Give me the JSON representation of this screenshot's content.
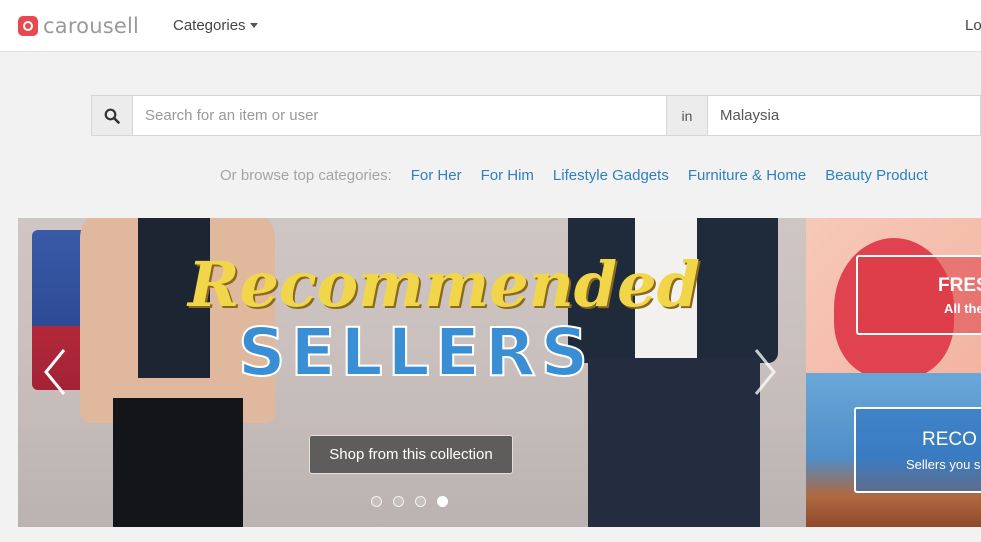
{
  "header": {
    "logo_text": "carousell",
    "categories_label": "Categories",
    "login_label": "Lo"
  },
  "search": {
    "placeholder": "Search for an item or user",
    "value": "",
    "in_label": "in",
    "location": "Malaysia"
  },
  "browse": {
    "label": "Or browse top categories:",
    "links": [
      "For Her",
      "For Him",
      "Lifestyle Gadgets",
      "Furniture & Home",
      "Beauty Product"
    ]
  },
  "banner": {
    "title_script": "Recommended",
    "title_main": "SELLERS",
    "cta_label": "Shop from this collection",
    "slide_count": 4,
    "active_slide": 4
  },
  "side_promos": [
    {
      "title": "FRES",
      "subtitle": "All the"
    },
    {
      "title": "RECO",
      "subtitle": "Sellers you s"
    }
  ],
  "colors": {
    "brand_red": "#e8484f",
    "link_blue": "#2f7fc1",
    "script_yellow": "#f2d64a",
    "sellers_blue": "#3a8fd4"
  },
  "icons": [
    "search-icon",
    "chevron-down-icon",
    "chevron-left-icon",
    "chevron-right-icon"
  ]
}
